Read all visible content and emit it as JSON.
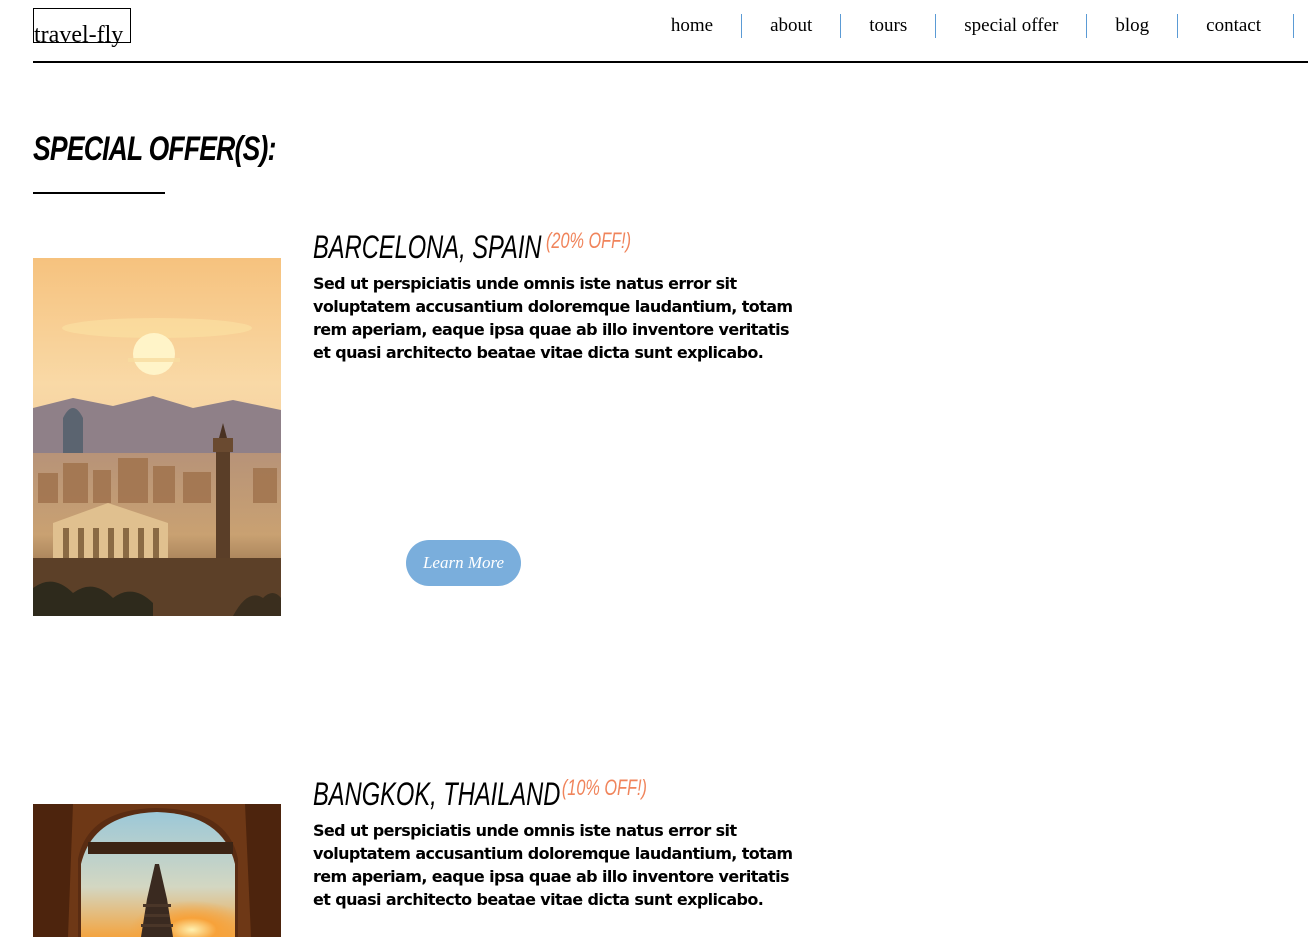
{
  "header": {
    "logo": "travel-fly",
    "nav": [
      "home",
      "about",
      "tours",
      "special offer",
      "blog",
      "contact"
    ]
  },
  "page": {
    "title": "SPECIAL OFFER(S):"
  },
  "offers": [
    {
      "destination": "BARCELONA, SPAIN",
      "discount": "(20% OFF!)",
      "description": "Sed ut perspiciatis unde omnis iste natus error sit voluptatem accusantium doloremque laudantium, totam rem aperiam, eaque ipsa quae ab illo inventore veritatis et quasi architecto beatae vitae dicta sunt explicabo.",
      "button": "Learn More"
    },
    {
      "destination": "BANGKOK, THAILAND",
      "discount": "(10% OFF!)",
      "description": "Sed ut perspiciatis unde omnis iste natus error sit voluptatem accusantium doloremque laudantium, totam rem aperiam, eaque ipsa quae ab illo inventore veritatis et quasi architecto beatae vitae dicta sunt explicabo."
    }
  ],
  "colors": {
    "accent": "#f0845b",
    "button": "#7aaedc",
    "nav_divider": "#5b9bd5"
  }
}
